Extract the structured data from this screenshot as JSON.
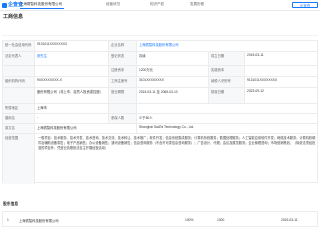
{
  "brand": {
    "name": "企查查",
    "accent": "#1677ff"
  },
  "tabs": [
    {
      "label": "上海赛智科技股份有限公司"
    },
    {
      "label": "经营状况"
    },
    {
      "label": "知识产权"
    },
    {
      "label": "发展历程"
    }
  ],
  "top_button": "企查查",
  "section": {
    "title": "工商信息",
    "sub": ""
  },
  "grid": {
    "rows": [
      {
        "label": "统一社会信用代码",
        "value": "9131011XXXXXXXX",
        "label2": "企业名称",
        "value2": "上海赛智科技股份有限公司",
        "label3": "",
        "value3": ""
      },
      {
        "label": "法定代表人",
        "value": "张先生",
        "label2": "登记状态",
        "value2": "存续",
        "label3": "成立日期",
        "value3": "2015-03-11"
      },
      {
        "label": "",
        "value": "",
        "label2": "注册资本",
        "value2": "1200万元",
        "label3": "实缴资本",
        "value3": ""
      },
      {
        "label": "组织机构代码",
        "value": "9XXXXXXXXX-X",
        "label2": "工商注册号",
        "value2": "3101XXXXXXXX",
        "label3": "纳税人识别号",
        "value3": "9131011XXXXXXXX"
      },
      {
        "label": "",
        "value": "股份有限公司（非上市、自然人投资或控股）",
        "label2": "营业期限",
        "value2": "2015-03-11 至 2065-03-10",
        "label3": "核准日期",
        "value3": "2023-09-12"
      },
      {
        "label": "所属地区",
        "value": "上海市",
        "label2": "",
        "value2": "",
        "label3": "",
        "value3": ""
      },
      {
        "label": "曾用名",
        "value": "-",
        "label2": "参保人数",
        "value2": "少于50人",
        "label3": "",
        "value3": ""
      },
      {
        "label": "英文名",
        "value": "上海赛智科技股份有限公司",
        "label2": "",
        "value2": "Shanghai SaiZhi Technology Co., Ltd.",
        "label3": "",
        "value3": ""
      }
    ],
    "scope_label": "经营范围",
    "scope_text": "一般项目：技术服务、技术开发、技术咨询、技术交流、技术转让、技术推广；软件开发；信息系统集成服务；计算机系统服务；数据处理服务；人工智能应用软件开发；网络技术服务；计算机软硬件及辅助设备零售；电子产品销售；办公设备销售；通讯设备销售；信息咨询服务（不含许可类信息咨询服务）；广告设计、代理；会议及展览服务；企业管理咨询；市场营销策划。（除依法须经批准的项目外，凭营业执照依法自主开展经营活动）"
  },
  "bottom": {
    "title": "股东信息",
    "row": {
      "index": "1",
      "name": "上海赛智科技股份有限公司",
      "percent": "100%",
      "amount": "1000",
      "date": "2015-03-11"
    }
  }
}
